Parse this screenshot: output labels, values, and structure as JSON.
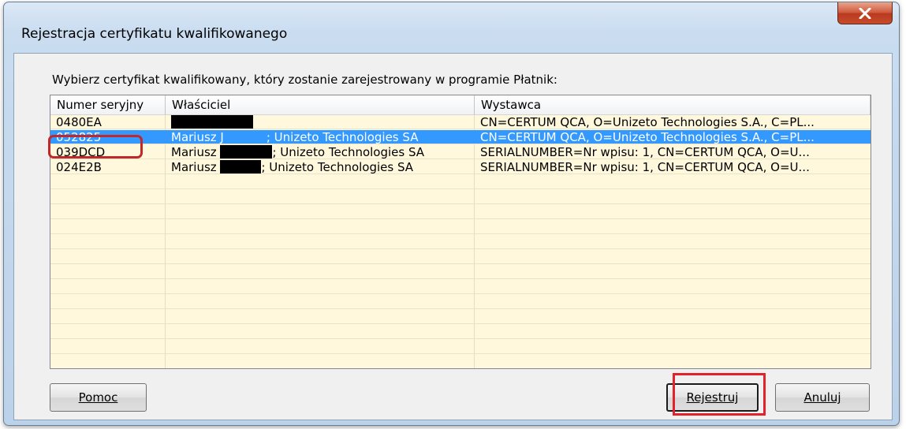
{
  "window": {
    "title": "Rejestracja certyfikatu kwalifikowanego"
  },
  "dialog": {
    "prompt": "Wybierz certyfikat kwalifikowany, który zostanie zarejestrowany w programie Płatnik:"
  },
  "table": {
    "columns": [
      "Numer seryjny",
      "Właściciel",
      "Wystawca"
    ],
    "rows": [
      {
        "serial": "0480EA",
        "owner_prefix": "",
        "owner_suffix": "",
        "issuer": "CN=CERTUM QCA, O=Unizeto Technologies S.A., C=PL...",
        "selected": false
      },
      {
        "serial": "052825",
        "owner_prefix": "Mariusz J",
        "owner_suffix": "; Unizeto Technologies SA",
        "issuer": "CN=CERTUM QCA, O=Unizeto Technologies S.A., C=PL...",
        "selected": true
      },
      {
        "serial": "039DCD",
        "owner_prefix": "Mariusz",
        "owner_suffix": "; Unizeto Technologies SA",
        "issuer": "SERIALNUMBER=Nr wpisu: 1, CN=CERTUM QCA, O=U...",
        "selected": false
      },
      {
        "serial": "024E2B",
        "owner_prefix": "Mariusz",
        "owner_suffix": "; Unizeto Technologies SA",
        "issuer": "SERIALNUMBER=Nr wpisu: 1, CN=CERTUM QCA, O=U...",
        "selected": false
      }
    ]
  },
  "buttons": {
    "help": "Pomoc",
    "register": "Rejestruj",
    "cancel": "Anuluj"
  },
  "colors": {
    "selection": "#3399ff",
    "list_background": "#fff8dc",
    "annotation_red": "#e3212a"
  },
  "icons": {
    "close": "close-x-icon"
  }
}
